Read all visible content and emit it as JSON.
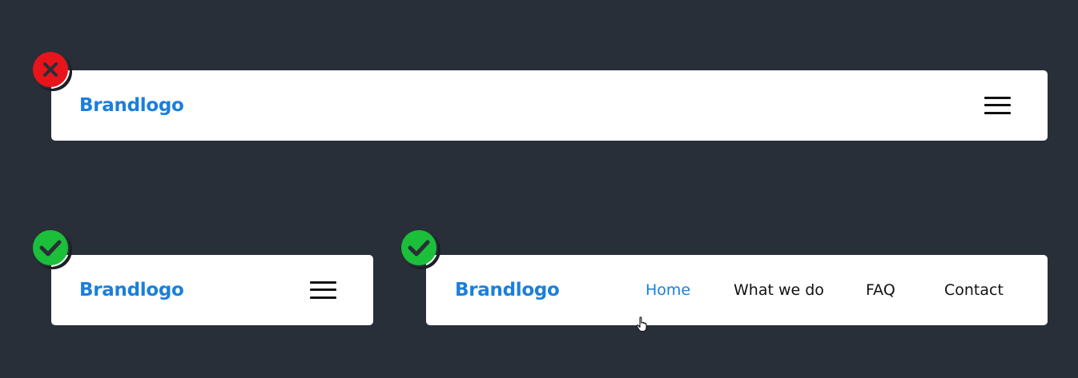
{
  "colors": {
    "background": "#282f38",
    "navbar_bg": "#ffffff",
    "brand": "#1a7fdc",
    "link_active": "#1a7fdc",
    "link_default": "#111111",
    "badge_bad": "#e8141c",
    "badge_good": "#1bbf3a",
    "badge_glyph": "#2a2f36"
  },
  "examples": [
    {
      "verdict": "bad",
      "badge_icon": "x-mark-icon",
      "navbar": {
        "brand": "Brandlogo",
        "menu_icon": "hamburger-menu-icon"
      }
    },
    {
      "verdict": "good",
      "badge_icon": "checkmark-icon",
      "navbar": {
        "brand": "Brandlogo",
        "menu_icon": "hamburger-menu-icon"
      }
    },
    {
      "verdict": "good",
      "badge_icon": "checkmark-icon",
      "navbar": {
        "brand": "Brandlogo",
        "links": [
          {
            "label": "Home",
            "active": true
          },
          {
            "label": "What we do",
            "active": false
          },
          {
            "label": "FAQ",
            "active": false
          },
          {
            "label": "Contact",
            "active": false
          }
        ]
      }
    }
  ],
  "cursor_icon": "hand-pointer-icon"
}
